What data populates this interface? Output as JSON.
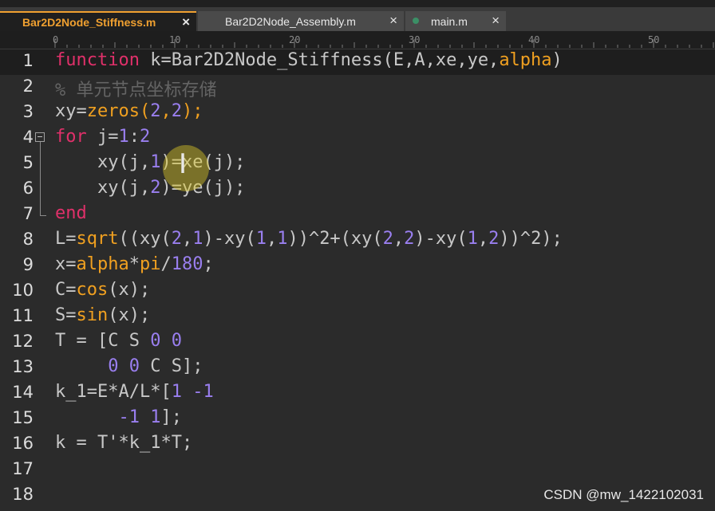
{
  "tabs": [
    {
      "label": "Bar2D2Node_Stiffness.m",
      "active": true,
      "close": "×"
    },
    {
      "label": "Bar2D2Node_Assembly.m",
      "active": false,
      "close": "×"
    },
    {
      "label": "main.m",
      "active": false,
      "close": "×"
    }
  ],
  "ruler": {
    "ticks": [
      "0",
      "10",
      "20",
      "30",
      "40",
      "50"
    ]
  },
  "editor": {
    "line_numbers": [
      "1",
      "2",
      "3",
      "4",
      "5",
      "6",
      "7",
      "8",
      "9",
      "10",
      "11",
      "12",
      "13",
      "14",
      "15",
      "16",
      "17",
      "18"
    ],
    "current_line": 1,
    "lines": [
      [
        {
          "t": "function",
          "c": "kw"
        },
        {
          "t": " k=Bar2D2Node_Stiffness(E,A,xe,ye,",
          "c": "plain"
        },
        {
          "t": "alpha",
          "c": "fn"
        },
        {
          "t": ")",
          "c": "plain"
        }
      ],
      [
        {
          "t": "% 单元节点坐标存储",
          "c": "cm"
        }
      ],
      [
        {
          "t": "xy=",
          "c": "plain"
        },
        {
          "t": "zeros",
          "c": "fn"
        },
        {
          "t": "(",
          "c": "fn"
        },
        {
          "t": "2",
          "c": "num"
        },
        {
          "t": ",",
          "c": "fn"
        },
        {
          "t": "2",
          "c": "num"
        },
        {
          "t": ");",
          "c": "fn"
        }
      ],
      [
        {
          "t": "for",
          "c": "kw"
        },
        {
          "t": " j=",
          "c": "plain"
        },
        {
          "t": "1",
          "c": "num"
        },
        {
          "t": ":",
          "c": "plain"
        },
        {
          "t": "2",
          "c": "num"
        }
      ],
      [
        {
          "t": "    xy(j,",
          "c": "plain"
        },
        {
          "t": "1",
          "c": "num"
        },
        {
          "t": ")=xe(j);",
          "c": "plain"
        }
      ],
      [
        {
          "t": "    xy(j,",
          "c": "plain"
        },
        {
          "t": "2",
          "c": "num"
        },
        {
          "t": ")=ye(j);",
          "c": "plain"
        }
      ],
      [
        {
          "t": "end",
          "c": "kw"
        }
      ],
      [
        {
          "t": "L=",
          "c": "plain"
        },
        {
          "t": "sqrt",
          "c": "fn"
        },
        {
          "t": "((xy(",
          "c": "plain"
        },
        {
          "t": "2",
          "c": "num"
        },
        {
          "t": ",",
          "c": "plain"
        },
        {
          "t": "1",
          "c": "num"
        },
        {
          "t": ")-xy(",
          "c": "plain"
        },
        {
          "t": "1",
          "c": "num"
        },
        {
          "t": ",",
          "c": "plain"
        },
        {
          "t": "1",
          "c": "num"
        },
        {
          "t": "))^2+(xy(",
          "c": "plain"
        },
        {
          "t": "2",
          "c": "num"
        },
        {
          "t": ",",
          "c": "plain"
        },
        {
          "t": "2",
          "c": "num"
        },
        {
          "t": ")-xy(",
          "c": "plain"
        },
        {
          "t": "1",
          "c": "num"
        },
        {
          "t": ",",
          "c": "plain"
        },
        {
          "t": "2",
          "c": "num"
        },
        {
          "t": "))^2);",
          "c": "plain"
        }
      ],
      [
        {
          "t": "x=",
          "c": "plain"
        },
        {
          "t": "alpha",
          "c": "fn"
        },
        {
          "t": "*",
          "c": "plain"
        },
        {
          "t": "pi",
          "c": "fn"
        },
        {
          "t": "/",
          "c": "plain"
        },
        {
          "t": "180",
          "c": "num"
        },
        {
          "t": ";",
          "c": "plain"
        }
      ],
      [
        {
          "t": "C=",
          "c": "plain"
        },
        {
          "t": "cos",
          "c": "fn"
        },
        {
          "t": "(x);",
          "c": "plain"
        }
      ],
      [
        {
          "t": "S=",
          "c": "plain"
        },
        {
          "t": "sin",
          "c": "fn"
        },
        {
          "t": "(x);",
          "c": "plain"
        }
      ],
      [
        {
          "t": "T = [C S ",
          "c": "plain"
        },
        {
          "t": "0 0",
          "c": "num"
        }
      ],
      [
        {
          "t": "     ",
          "c": "plain"
        },
        {
          "t": "0 0",
          "c": "num"
        },
        {
          "t": " C S];",
          "c": "plain"
        }
      ],
      [
        {
          "t": "k_1=E*A/L*[",
          "c": "plain"
        },
        {
          "t": "1 -1",
          "c": "num"
        }
      ],
      [
        {
          "t": "      ",
          "c": "plain"
        },
        {
          "t": "-1 1",
          "c": "num"
        },
        {
          "t": "];",
          "c": "plain"
        }
      ],
      [
        {
          "t": "k = T'*k_1*T;",
          "c": "plain"
        }
      ],
      [],
      []
    ]
  },
  "watermark": "CSDN @mw_1422102031",
  "colors": {
    "keyword": "#e0306a",
    "function": "#f0a020",
    "number": "#9a7ff0",
    "comment": "#646464",
    "text": "#c8c8c8",
    "active_tab": "#f0a030"
  }
}
